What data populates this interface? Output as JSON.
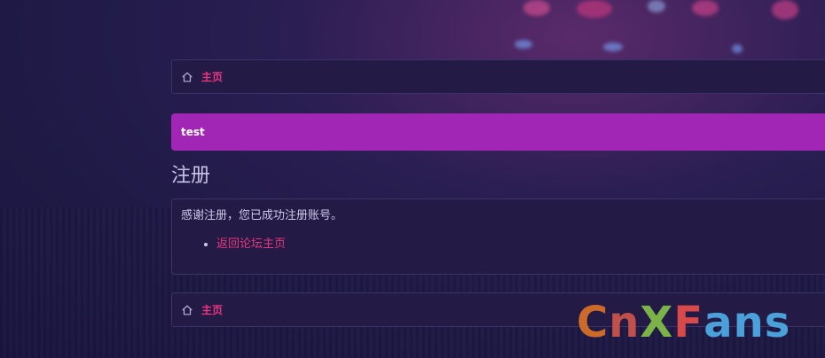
{
  "breadcrumb_top": {
    "home_label": "主页"
  },
  "notice": {
    "text": "test"
  },
  "page_title": "注册",
  "message": {
    "text": "感谢注册，您已成功注册账号。",
    "links": [
      {
        "label": "返回论坛主页"
      }
    ]
  },
  "breadcrumb_bottom": {
    "home_label": "主页"
  },
  "watermark": {
    "letters": [
      "C",
      "n",
      "X",
      "F",
      "a",
      "n",
      "s"
    ],
    "colors": [
      "#cc6a2a",
      "#c0504a",
      "#7bb348",
      "#d84a4a",
      "#4aa0d8",
      "#4aa0d8",
      "#4aa0d8"
    ]
  },
  "colors": {
    "accent": "#e8367e",
    "notice_bg": "#a126b6",
    "panel_bg": "#231b45"
  }
}
